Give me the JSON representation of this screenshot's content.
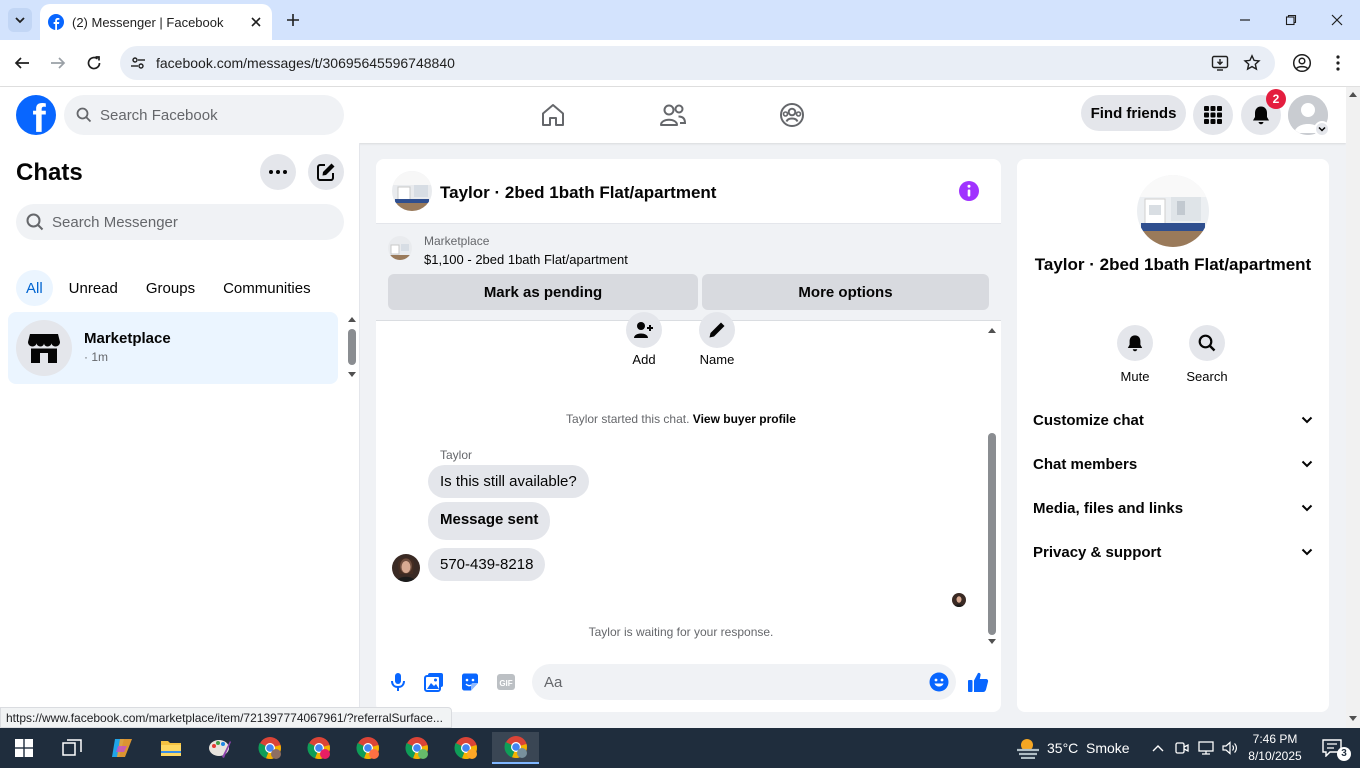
{
  "browser": {
    "tab_title": "(2) Messenger | Facebook",
    "url": "facebook.com/messages/t/30695645596748840",
    "status_url": "https://www.facebook.com/marketplace/item/721397774067961/?referralSurface..."
  },
  "fb_header": {
    "search_placeholder": "Search Facebook",
    "find_friends": "Find friends",
    "notification_count": "2"
  },
  "chats": {
    "title": "Chats",
    "search_placeholder": "Search Messenger",
    "filters": [
      "All",
      "Unread",
      "Groups",
      "Communities"
    ],
    "active_filter": "All",
    "items": [
      {
        "name": "Marketplace",
        "time": "· 1m"
      }
    ]
  },
  "conversation": {
    "title": "Taylor · 2bed 1bath Flat/apartment",
    "marketplace": {
      "label": "Marketplace",
      "listing": "$1,100 - 2bed 1bath Flat/apartment",
      "mark_pending": "Mark as pending",
      "more_options": "More options"
    },
    "actions": {
      "add": "Add",
      "name": "Name"
    },
    "started_text": "Taylor started this chat.",
    "buyer_profile_link": "View buyer profile",
    "sender": "Taylor",
    "messages": [
      "Is this still available?",
      "Message sent",
      "570-439-8218"
    ],
    "waiting_text": "Taylor is waiting for your response.",
    "composer_placeholder": "Aa"
  },
  "info_panel": {
    "title": "Taylor · 2bed 1bath Flat/apartment",
    "mute": "Mute",
    "search": "Search",
    "sections": [
      "Customize chat",
      "Chat members",
      "Media, files and links",
      "Privacy & support"
    ]
  },
  "taskbar": {
    "weather_temp": "35°C",
    "weather_desc": "Smoke",
    "time": "7:46 PM",
    "date": "8/10/2025",
    "notification_count": "3"
  },
  "colors": {
    "fb_blue": "#0866ff",
    "active_filter_bg": "#ebf5ff",
    "badge_red": "#e41e3f",
    "info_purple": "#a033ff"
  }
}
